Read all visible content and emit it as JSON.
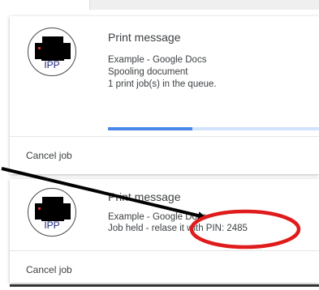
{
  "notifications": [
    {
      "title": "Print message",
      "lines": [
        "Example - Google Docs",
        "Spooling document",
        "1 print job(s) in the queue."
      ],
      "progress": 0.4,
      "action_label": "Cancel job",
      "icon": "printer-icon",
      "icon_label": "IPP"
    },
    {
      "title": "Print message",
      "lines": [
        "Example - Google Docs",
        "Job held - relase it with PIN: 2485"
      ],
      "action_label": "Cancel job",
      "icon": "printer-icon",
      "icon_label": "IPP"
    }
  ],
  "colors": {
    "progress_fill": "#4a86e8",
    "progress_track": "#d2e3fc",
    "highlight_ring": "#e01b1b",
    "ipp_text": "#1a237e"
  }
}
